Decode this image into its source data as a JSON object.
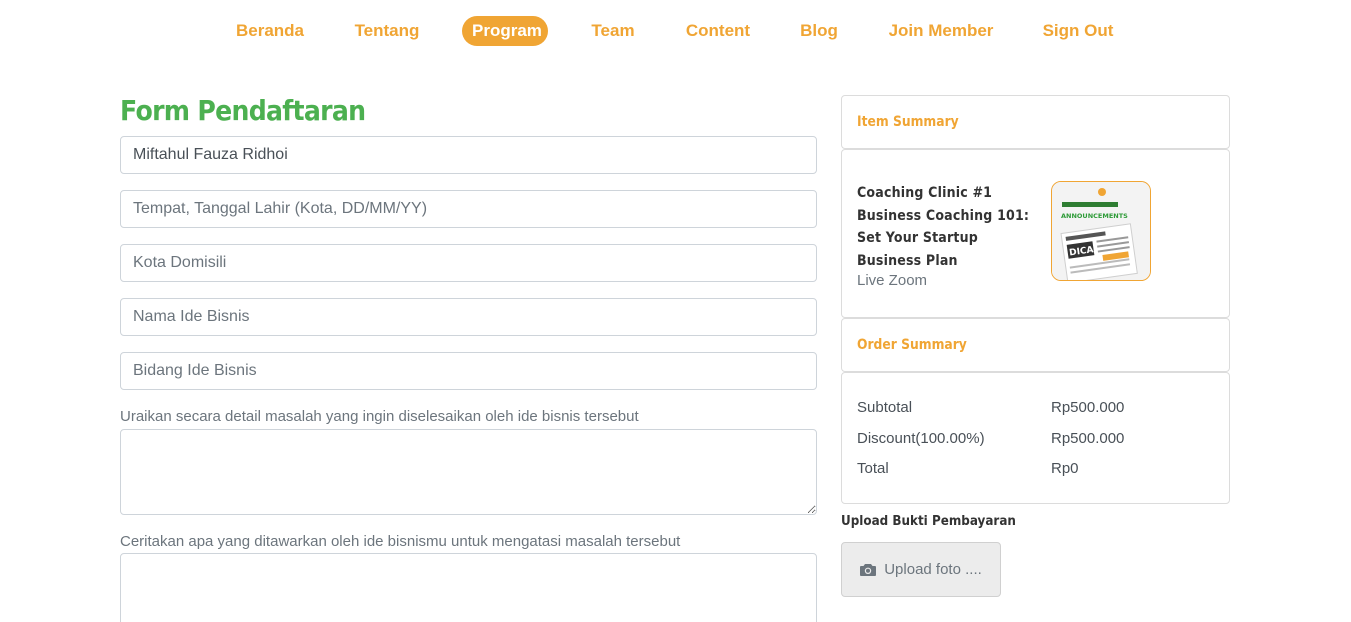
{
  "nav": {
    "items": [
      {
        "label": "Beranda"
      },
      {
        "label": "Tentang"
      },
      {
        "label": "Program",
        "active": true
      },
      {
        "label": "Team"
      },
      {
        "label": "Content"
      },
      {
        "label": "Blog"
      },
      {
        "label": "Join Member"
      },
      {
        "label": "Sign Out"
      }
    ]
  },
  "form": {
    "title": "Form Pendaftaran",
    "name_value": "Miftahul Fauza Ridhoi",
    "birth_placeholder": "Tempat, Tanggal Lahir (Kota, DD/MM/YY)",
    "city_placeholder": "Kota Domisili",
    "idea_name_placeholder": "Nama Ide Bisnis",
    "idea_field_placeholder": "Bidang Ide Bisnis",
    "problem_label": "Uraikan secara detail masalah yang ingin diselesaikan oleh ide bisnis tersebut",
    "solution_label": "Ceritakan apa yang ditawarkan oleh ide bisnismu untuk mengatasi masalah tersebut"
  },
  "item_summary": {
    "heading": "Item Summary",
    "title": "Coaching Clinic #1 Business Coaching 101: Set Your Startup Business Plan",
    "subtitle": "Live Zoom",
    "thumb_banner": "ANNOUNCEMENTS",
    "thumb_badge": "DICARI"
  },
  "order_summary": {
    "heading": "Order Summary",
    "rows": [
      {
        "label": "Subtotal",
        "value": "Rp500.000"
      },
      {
        "label": "Discount(100.00%)",
        "value": "Rp500.000"
      },
      {
        "label": "Total",
        "value": "Rp0"
      }
    ]
  },
  "upload": {
    "title": "Upload Bukti Pembayaran",
    "button_label": "Upload foto ....",
    "icon": "camera-icon"
  },
  "colors": {
    "accent": "#f0a534",
    "title_green": "#4cb050"
  }
}
